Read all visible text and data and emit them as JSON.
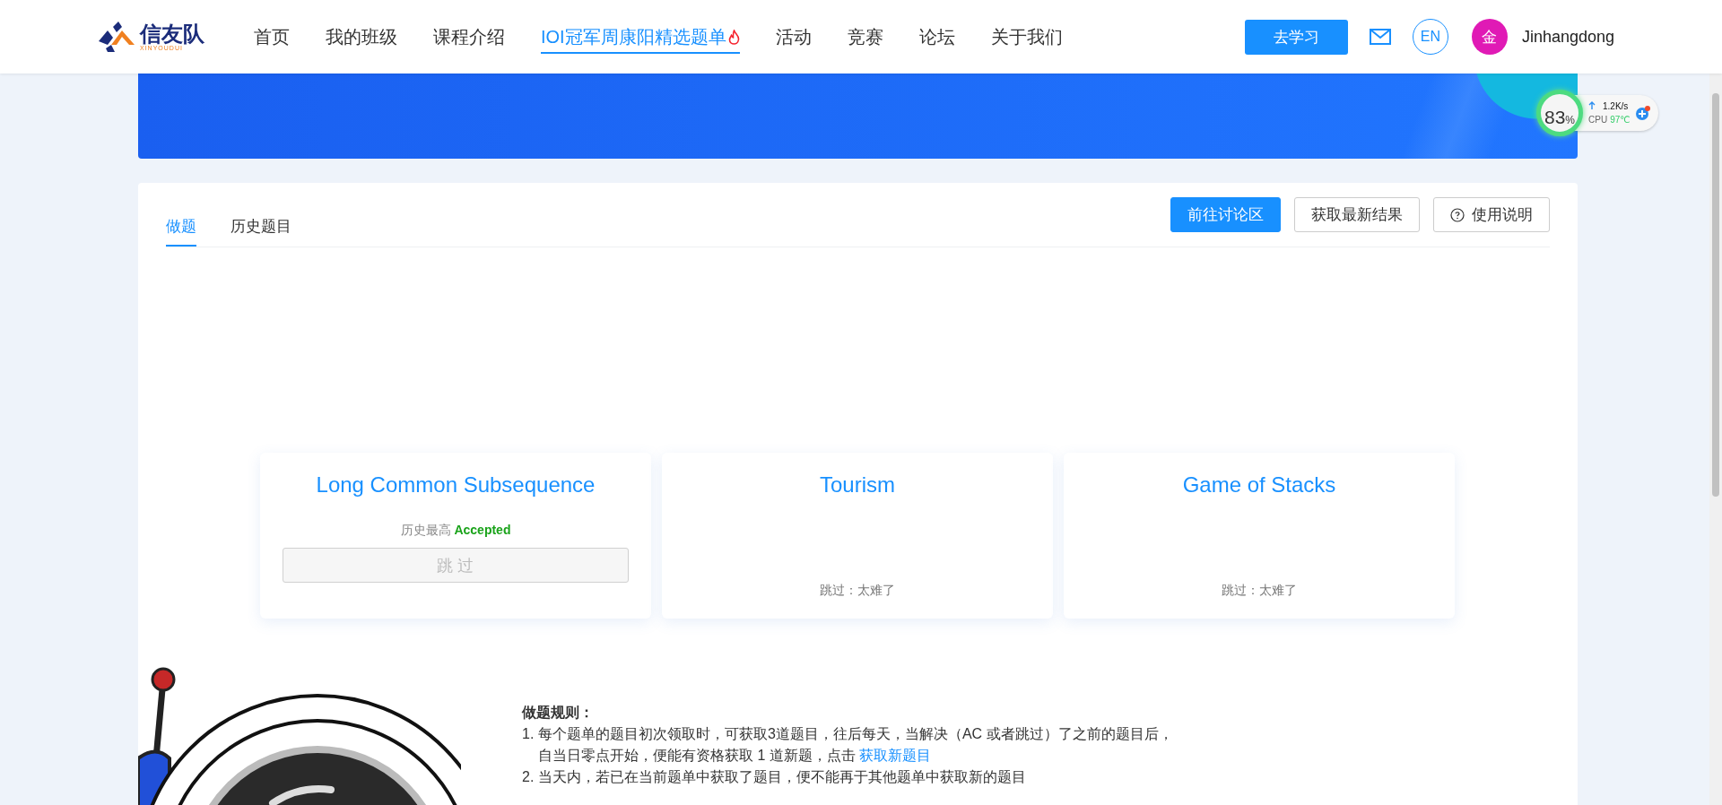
{
  "nav": {
    "logo": {
      "name": "信友队",
      "sub": "XINYOUDUI"
    },
    "items": [
      {
        "label": "首页",
        "selected": false,
        "hot": false
      },
      {
        "label": "我的班级",
        "selected": false,
        "hot": false
      },
      {
        "label": "课程介绍",
        "selected": false,
        "hot": false
      },
      {
        "label": "IOI冠军周康阳精选题单",
        "selected": true,
        "hot": true
      },
      {
        "label": "活动",
        "selected": false,
        "hot": false
      },
      {
        "label": "竞赛",
        "selected": false,
        "hot": false
      },
      {
        "label": "论坛",
        "selected": false,
        "hot": false
      },
      {
        "label": "关于我们",
        "selected": false,
        "hot": false
      }
    ],
    "cta": "去学习",
    "language": "EN",
    "user": {
      "avatar": "金",
      "name": "Jinhangdong"
    }
  },
  "monitor": {
    "percent": "83",
    "unit": "%",
    "speed": "1.2K/s",
    "cpu_label": "CPU",
    "cpu_temp": "97℃"
  },
  "tabs": [
    {
      "label": "做题",
      "selected": true
    },
    {
      "label": "历史题目",
      "selected": false
    }
  ],
  "actions": [
    {
      "label": "前往讨论区",
      "kind": "primary"
    },
    {
      "label": "获取最新结果",
      "kind": "default"
    },
    {
      "label": "使用说明",
      "kind": "help"
    }
  ],
  "problems": [
    {
      "title": "Long Common Subsequence",
      "kind": "attempted",
      "best_label": "历史最高",
      "best_result": "Accepted",
      "skip_button": "跳 过"
    },
    {
      "title": "Tourism",
      "kind": "skipped",
      "note": "跳过：太难了"
    },
    {
      "title": "Game of Stacks",
      "kind": "skipped",
      "note": "跳过：太难了"
    }
  ],
  "rules": {
    "heading": "做题规则：",
    "items": [
      {
        "number": "1.",
        "text": "每个题单的题目初次领取时，可获取3道题目，往后每天，当解决（AC 或者跳过）了之前的题目后，自当日零点开始，便能有资格获取 1 道新题，点击 ",
        "link": "获取新题目"
      },
      {
        "number": "2.",
        "text": "当天内，若已在当前题单中获取了题目，便不能再于其他题单中获取新的题目"
      }
    ]
  }
}
